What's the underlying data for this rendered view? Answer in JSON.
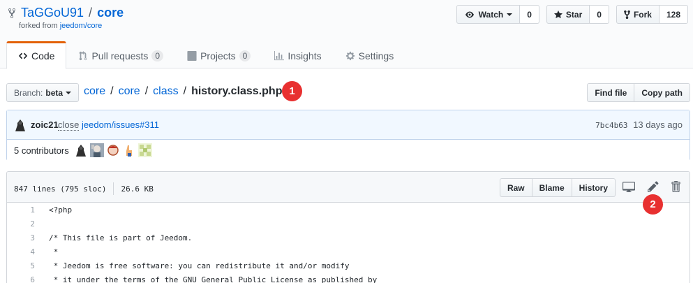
{
  "repo": {
    "owner": "TaGGoU91",
    "separator": "/",
    "name": "core",
    "forked_prefix": "forked from ",
    "forked_link": "jeedom/core"
  },
  "actions": {
    "watch_label": "Watch",
    "watch_count": "0",
    "star_label": "Star",
    "star_count": "0",
    "fork_label": "Fork",
    "fork_count": "128"
  },
  "nav": {
    "code": "Code",
    "pull_requests": "Pull requests",
    "pull_requests_count": "0",
    "projects": "Projects",
    "projects_count": "0",
    "insights": "Insights",
    "settings": "Settings"
  },
  "file_nav": {
    "branch_label": "Branch:",
    "branch_name": "beta",
    "crumbs": [
      "core",
      "core",
      "class"
    ],
    "final": "history.class.php",
    "find_file": "Find file",
    "copy_path": "Copy path"
  },
  "markers": [
    "1",
    "2"
  ],
  "commit": {
    "author": "zoic21",
    "message_word": "close",
    "message_link": "jeedom/issues#311",
    "sha": "7bc4b63",
    "time": "13 days ago",
    "contributors_label": "5 contributors"
  },
  "file": {
    "lines": "847 lines (795 sloc)",
    "size": "26.6 KB",
    "raw": "Raw",
    "blame": "Blame",
    "history": "History"
  },
  "code_lines": [
    {
      "num": "1",
      "text": "<?php"
    },
    {
      "num": "2",
      "text": ""
    },
    {
      "num": "3",
      "text": "/* This file is part of Jeedom."
    },
    {
      "num": "4",
      "text": " *"
    },
    {
      "num": "5",
      "text": " * Jeedom is free software: you can redistribute it and/or modify"
    },
    {
      "num": "6",
      "text": " * it under the terms of the GNU General Public License as published by"
    }
  ],
  "colors": {
    "link": "#0366d6",
    "tab_accent": "#e36209",
    "marker": "#e83030",
    "commit_bg": "#f1f8ff"
  }
}
